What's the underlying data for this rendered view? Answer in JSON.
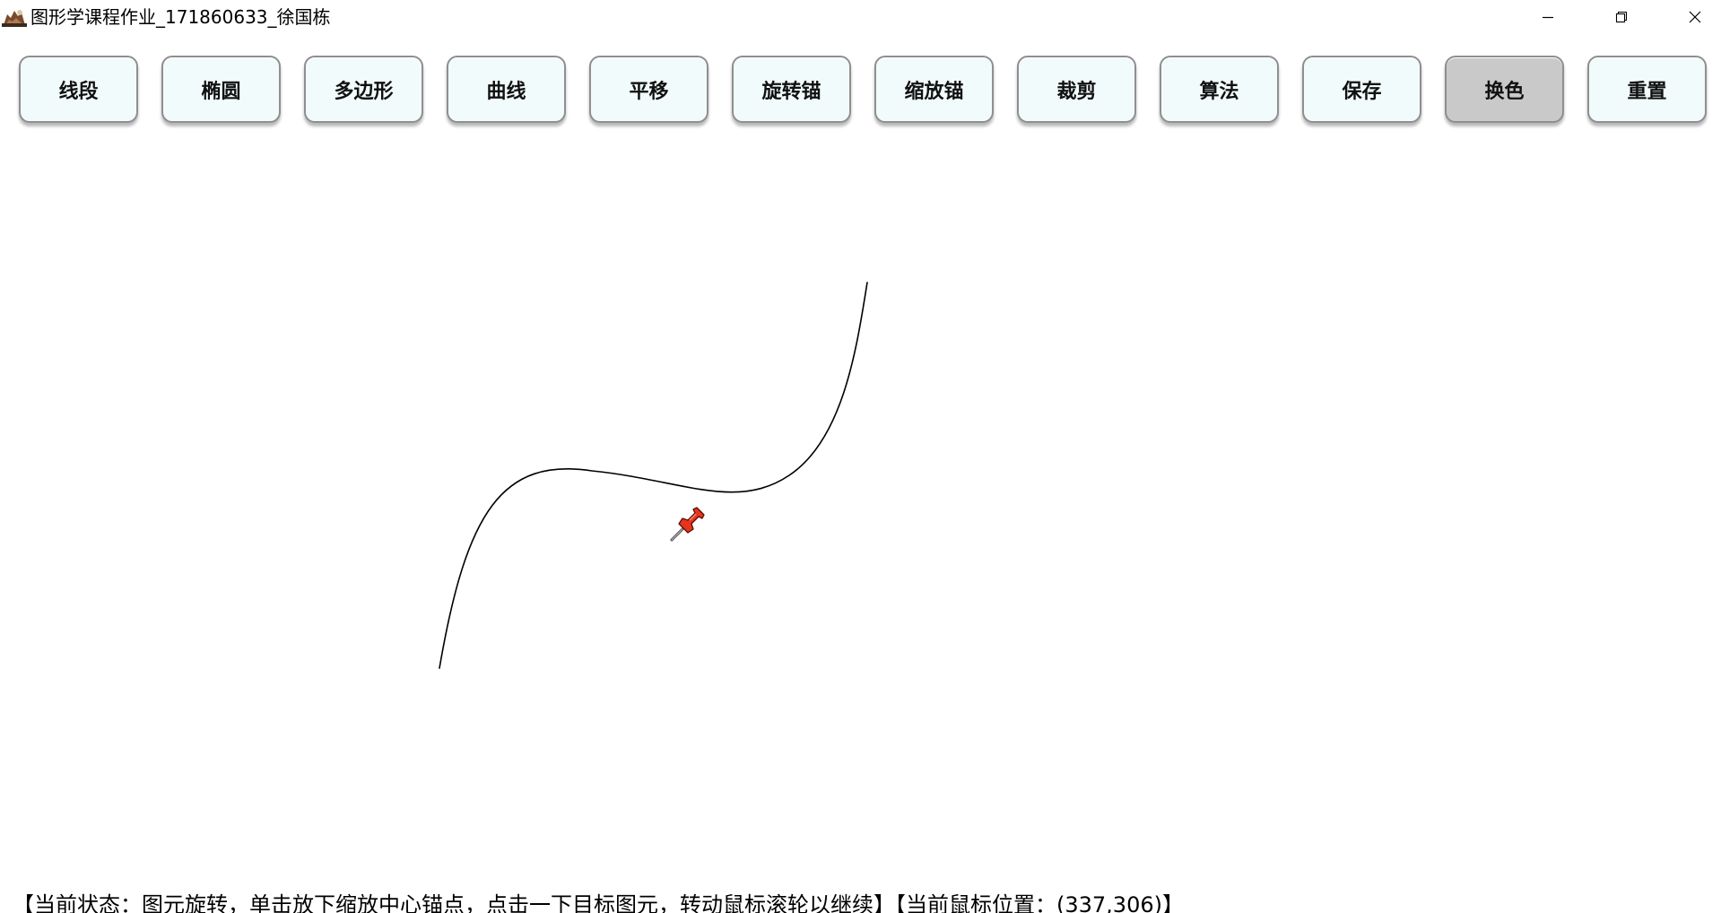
{
  "window": {
    "title": "图形学课程作业_171860633_徐国栋",
    "icon": "app-logo-icon",
    "controls": [
      "minimize-icon",
      "restore-icon",
      "close-icon"
    ]
  },
  "toolbar": {
    "buttons": [
      {
        "label": "线段",
        "active": false
      },
      {
        "label": "椭圆",
        "active": false
      },
      {
        "label": "多边形",
        "active": false
      },
      {
        "label": "曲线",
        "active": false
      },
      {
        "label": "平移",
        "active": false
      },
      {
        "label": "旋转锚",
        "active": false
      },
      {
        "label": "缩放锚",
        "active": false
      },
      {
        "label": "裁剪",
        "active": false
      },
      {
        "label": "算法",
        "active": false
      },
      {
        "label": "保存",
        "active": false
      },
      {
        "label": "换色",
        "active": true
      },
      {
        "label": "重置",
        "active": false
      }
    ]
  },
  "canvas": {
    "stroke_color": "#000000",
    "anchor_icon": "pushpin-icon",
    "anchor_color": "#e8341c"
  },
  "status": {
    "text": "【当前状态：图元旋转，单击放下缩放中心锚点，点击一下目标图元，转动鼠标滚轮以继续】【当前鼠标位置：(337,306)】"
  },
  "colors": {
    "button_bg": "#f2fbfb",
    "button_active_bg": "#c9c9c9",
    "button_border": "#8f8f8f"
  }
}
